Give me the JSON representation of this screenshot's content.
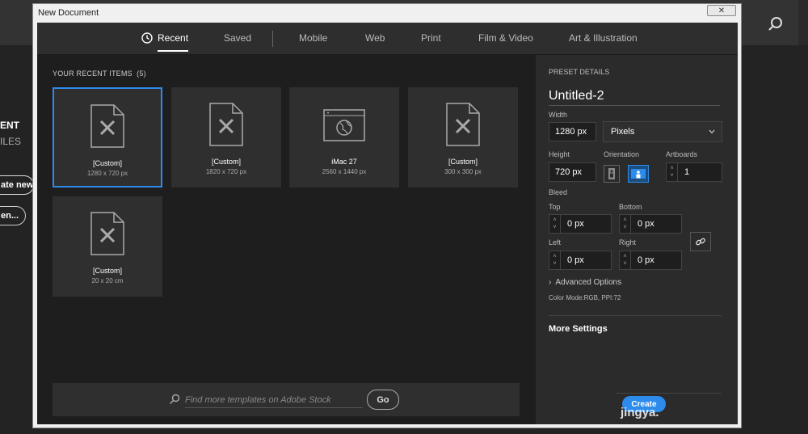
{
  "background_app": {
    "label_recent": "ENT",
    "label_files": "ILES",
    "btn_create_new": "ate new",
    "btn_open": "en..."
  },
  "dialog": {
    "title": "New Document",
    "close_label": "✕"
  },
  "tabs": [
    {
      "label": "Recent",
      "active": true
    },
    {
      "label": "Saved"
    },
    {
      "label": "Mobile"
    },
    {
      "label": "Web"
    },
    {
      "label": "Print"
    },
    {
      "label": "Film & Video"
    },
    {
      "label": "Art & Illustration"
    }
  ],
  "recent": {
    "heading": "YOUR RECENT ITEMS",
    "count": "(5)",
    "items": [
      {
        "title": "[Custom]",
        "size": "1280 x 720 px",
        "icon": "document-icon",
        "selected": true
      },
      {
        "title": "[Custom]",
        "size": "1820 x 720 px",
        "icon": "document-icon"
      },
      {
        "title": "iMac 27",
        "size": "2560 x 1440 px",
        "icon": "web-icon"
      },
      {
        "title": "[Custom]",
        "size": "300 x 300 px",
        "icon": "document-icon"
      },
      {
        "title": "[Custom]",
        "size": "20 x 20 cm",
        "icon": "document-icon"
      }
    ]
  },
  "stock_search": {
    "placeholder": "Find more templates on Adobe Stock",
    "go_label": "Go"
  },
  "preset": {
    "heading": "PRESET DETAILS",
    "name": "Untitled-2",
    "width_label": "Width",
    "width_value": "1280 px",
    "unit_value": "Pixels",
    "height_label": "Height",
    "height_value": "720 px",
    "orientation_label": "Orientation",
    "artboards_label": "Artboards",
    "artboards_value": "1",
    "bleed_label": "Bleed",
    "top_label": "Top",
    "top_value": "0 px",
    "bottom_label": "Bottom",
    "bottom_value": "0 px",
    "left_label": "Left",
    "left_value": "0 px",
    "right_label": "Right",
    "right_value": "0 px",
    "advanced_label": "Advanced Options",
    "color_mode": "Color Mode:RGB, PPI:72",
    "more_settings": "More Settings",
    "create_label": "Create",
    "watermark": "jingya."
  },
  "colors": {
    "accent": "#2d8ceb",
    "panel": "#2b2b2b",
    "card": "#2f2f2f"
  }
}
